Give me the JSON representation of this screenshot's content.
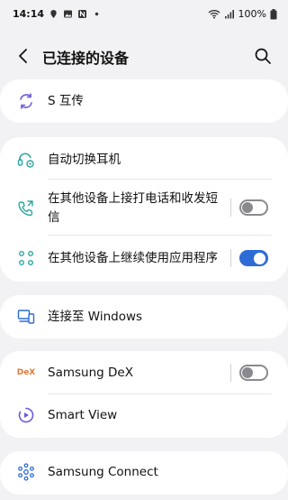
{
  "status_bar": {
    "time": "14:14",
    "battery": "100%"
  },
  "header": {
    "title": "已连接的设备"
  },
  "groups": [
    {
      "items": [
        {
          "label": "S 互传",
          "icon": "quick-share-icon"
        }
      ]
    },
    {
      "items": [
        {
          "label": "自动切换耳机",
          "icon": "earbuds-switch-icon"
        },
        {
          "label_line1": "在其他设备上接打电话和收发短",
          "label_line2": "信",
          "icon": "phone-share-icon",
          "toggle": "off"
        },
        {
          "label": "在其他设备上继续使用应用程序",
          "icon": "continue-apps-icon",
          "toggle": "on"
        }
      ]
    },
    {
      "items": [
        {
          "label": "连接至 Windows",
          "icon": "link-to-windows-icon"
        }
      ]
    },
    {
      "items": [
        {
          "label": "Samsung DeX",
          "icon": "dex-logo-icon",
          "icon_text": "DeX",
          "toggle": "off"
        },
        {
          "label": "Smart View",
          "icon": "smart-view-icon"
        }
      ]
    },
    {
      "items": [
        {
          "label": "Samsung Connect",
          "icon": "samsung-connect-icon"
        }
      ]
    }
  ],
  "colors": {
    "background": "#f2f2f4",
    "card": "#ffffff",
    "accent": "#2d6bd6",
    "icon_purple": "#6b5bd6",
    "icon_teal": "#2aa7a0",
    "dex_orange": "#e07a3a"
  }
}
